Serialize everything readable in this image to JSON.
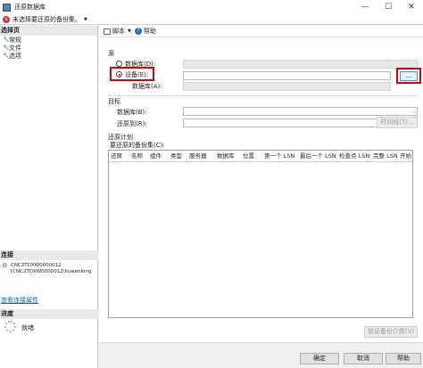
{
  "window": {
    "title": "还原数据库",
    "minimize": "—",
    "maximize": "☐",
    "close": "✕"
  },
  "error_bar": {
    "icon": "x",
    "message": "未选择要还原的备份集。",
    "caret": "▼"
  },
  "left_panel": {
    "pages_header": "选择页",
    "pages": [
      {
        "icon": "wrench-icon",
        "label": "常规"
      },
      {
        "icon": "wrench-icon",
        "label": "文件"
      },
      {
        "icon": "wrench-icon",
        "label": "选项"
      }
    ],
    "connection_header": "连接",
    "connection_line1": "CNC2TDXW0000012",
    "connection_line2": "[CNC2TDXW0000012\\liuwenlong",
    "connection_link": "查看连接属性",
    "progress_header": "进度",
    "progress_status": "就绪"
  },
  "toolbar": {
    "script_label": "脚本",
    "script_caret": "▼",
    "help_icon": "?",
    "help_label": "帮助"
  },
  "source": {
    "section_label": "源",
    "database_radio_label": "数据库(D):",
    "device_radio_label": "设备(E):",
    "device_selected": true,
    "browse_label": "...",
    "db_label": "数据库(A):"
  },
  "destination": {
    "section_label": "目标",
    "database_label": "数据库(B):",
    "restore_to_label": "还原到(R):",
    "timeline_button": "时间线(T)..."
  },
  "restore_plan": {
    "section_label": "还原计划",
    "sets_label": "要还原的备份集(C):",
    "columns": [
      "还原",
      "名称",
      "组件",
      "类型",
      "服务器",
      "数据库",
      "位置",
      "第一个 LSN",
      "最后一个 LSN",
      "检查点 LSN",
      "完整 LSN",
      "开始"
    ],
    "rows": [],
    "verify_button": "验证备份介质(V)"
  },
  "buttons": {
    "ok": "确定",
    "cancel": "取消",
    "help": "帮助"
  }
}
